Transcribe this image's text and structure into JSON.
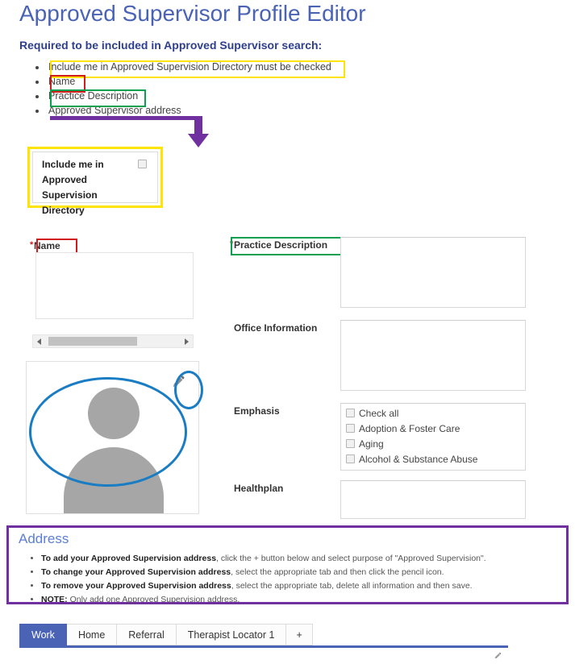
{
  "header": {
    "title": "Approved Supervisor Profile Editor",
    "subtitle": "Required to be included in Approved Supervisor search:"
  },
  "requirements": [
    {
      "text": "Include me in Approved Supervision Directory must be checked",
      "highlight": "yellow"
    },
    {
      "text": "Name",
      "highlight": "red"
    },
    {
      "text": "Practice Description",
      "highlight": "green"
    },
    {
      "text": "Approved Supervisor address",
      "highlight": "purple"
    }
  ],
  "include_me": {
    "label": "Include me in Approved Supervision Directory",
    "checked": false,
    "checkbox_name": "include-me-checkbox"
  },
  "form": {
    "name_label": "Name",
    "name_required": "*",
    "name_value": "",
    "practice_label": "Practice Description",
    "practice_required": "*",
    "practice_value": "",
    "office_label": "Office Information",
    "office_value": "",
    "emphasis_label": "Emphasis",
    "emphasis_options": [
      "Check all",
      "Adoption & Foster Care",
      "Aging",
      "Alcohol & Substance Abuse"
    ],
    "healthplan_label": "Healthplan",
    "healthplan_value": ""
  },
  "avatar": {
    "edit_icon": "pencil-icon"
  },
  "address": {
    "title": "Address",
    "items": [
      {
        "bold": "To add your Approved Supervision address",
        "rest": ", click the + button below and select purpose of \"Approved Supervision\"."
      },
      {
        "bold": "To change your Approved Supervision address",
        "rest": ", select the appropriate tab and then click the pencil icon."
      },
      {
        "bold": "To remove your Approved Supervision address",
        "rest": ", select the appropriate tab, delete all information and then save."
      },
      {
        "bold": "NOTE:",
        "rest": " Only add one Approved Supervision address."
      }
    ]
  },
  "tabs": {
    "items": [
      {
        "label": "Work",
        "active": true
      },
      {
        "label": "Home",
        "active": false
      },
      {
        "label": "Referral",
        "active": false
      },
      {
        "label": "Therapist Locator 1",
        "active": false
      },
      {
        "label": "+",
        "active": false
      }
    ]
  },
  "colors": {
    "title_blue": "#4a63b5",
    "subtitle_blue": "#2f3f8f",
    "annotation_yellow": "#ffe400",
    "annotation_red": "#d01c1c",
    "annotation_green": "#0aa050",
    "annotation_purple": "#7030a0",
    "annotation_blue": "#1a7dc4",
    "tab_active": "#4a63b5"
  }
}
